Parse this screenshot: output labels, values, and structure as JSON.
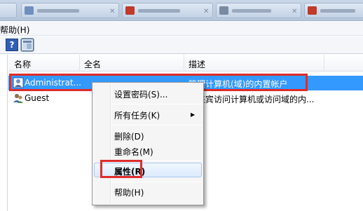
{
  "menubar": {
    "help_label": "帮助(H)"
  },
  "toolbar": {
    "help_icon_glyph": "?"
  },
  "columns": {
    "name": "名称",
    "fullname": "全名",
    "description": "描述"
  },
  "users": [
    {
      "name": "Administrat...",
      "description": "管理计算机(域)的内置帐户",
      "selected": true
    },
    {
      "name": "Guest",
      "description": "供来宾访问计算机或访问域的内..."
    }
  ],
  "context_menu": {
    "items": [
      {
        "label": "设置密码(S)..."
      },
      {
        "label": "所有任务(K)",
        "submenu": true
      },
      {
        "label": "删除(D)"
      },
      {
        "label": "重命名(M)"
      },
      {
        "label": "属性(R)",
        "highlighted": true,
        "bold": true
      },
      {
        "label": "帮助(H)"
      }
    ],
    "submenu_arrow": "▶"
  },
  "colors": {
    "selection": "#3399ff",
    "annotation_red": "#e02b2b"
  }
}
